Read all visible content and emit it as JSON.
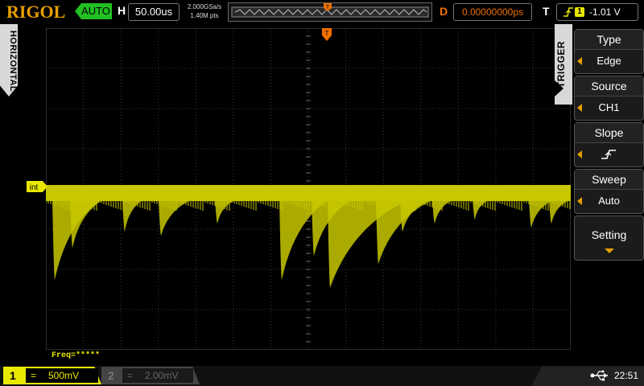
{
  "header": {
    "brand": "RIGOL",
    "run_state": "AUTO",
    "h_label": "H",
    "timebase": "50.00us",
    "sample_rate": "2.000GSa/s",
    "memory_depth": "1.40M pts",
    "d_label": "D",
    "trigger_delay": "0.00000000ps",
    "t_label": "T",
    "trigger_source_badge": "1",
    "trigger_level": "-1.01 V"
  },
  "left_tab": "HORIZONTAL",
  "trigger_tab": "TRIGGER",
  "waveform": {
    "marker_label": "int",
    "trigger_marker": "T",
    "freq_readout": "Freq=*****",
    "color": "#c8c800"
  },
  "trigger_menu": {
    "type_title": "Type",
    "type_value": "Edge",
    "source_title": "Source",
    "source_value": "CH1",
    "slope_title": "Slope",
    "sweep_title": "Sweep",
    "sweep_value": "Auto",
    "setting_title": "Setting"
  },
  "channels": {
    "ch1_number": "1",
    "ch1_coupling": "=",
    "ch1_scale": "500mV",
    "ch2_number": "2",
    "ch2_coupling": "=",
    "ch2_scale": "2.00mV"
  },
  "status": {
    "time": "22:51"
  },
  "colors": {
    "brand": "#e8a000",
    "run_state": "#22c022",
    "delay": "#f07000",
    "channel1": "#e8e800"
  }
}
